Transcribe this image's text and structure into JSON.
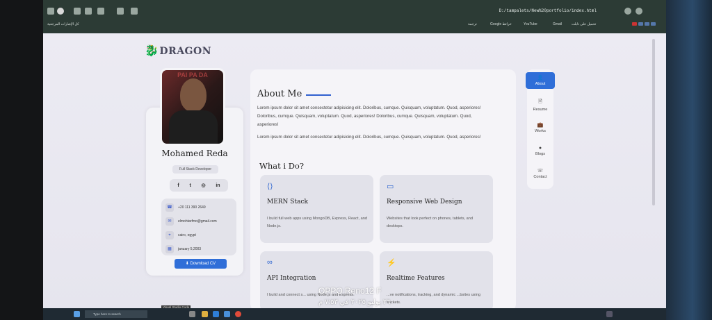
{
  "browser": {
    "url": "D:/tampalets/New%20portfolio/index.html",
    "bookmarks": [
      "تحميل على تابلت",
      "Gmail",
      "YouTube",
      "Google خرائط",
      "ترجمة"
    ],
    "bookmarks_left": "كل الإشارات المرجعية"
  },
  "logo": {
    "text": "DRAGON",
    "mark": "🐉"
  },
  "profile": {
    "photo_text": "PAI PA DA",
    "name": "Mohamed Reda",
    "role": "Full Stack Developer",
    "socials": [
      "f",
      "t",
      "◎",
      "in"
    ],
    "contacts": [
      {
        "icon": "phone-icon",
        "glyph": "☎",
        "text": "+20 111 390 2649"
      },
      {
        "icon": "mail-icon",
        "glyph": "✉",
        "text": "elmohtarfmo@gmail.com"
      },
      {
        "icon": "location-icon",
        "glyph": "⌖",
        "text": "cairo, egypt"
      },
      {
        "icon": "calendar-icon",
        "glyph": "▦",
        "text": "january 5,2003"
      }
    ],
    "download_label": "Download CV"
  },
  "about": {
    "title": "About Me",
    "para1": "Lorem ipsum dolor sit amet consectetur adipisicing elit. Doloribus, cumque. Quisquam, voluptatum. Quod, asperiores! Doloribus, cumque. Quisquam, voluptatum. Quod, asperiores! Doloribus, cumque. Quisquam, voluptatum. Quod, asperiores!",
    "para2": "Lorem ipsum dolor sit amet consectetur adipisicing elit. Doloribus, cumque. Quisquam, voluptatum. Quod, asperiores!",
    "what_title": "What i Do?"
  },
  "services": [
    {
      "icon": "code-icon",
      "glyph": "⟨⟩",
      "title": "MERN Stack",
      "desc": "I build full web apps using MongoDB, Express, React, and Node.js."
    },
    {
      "icon": "monitor-icon",
      "glyph": "▭",
      "title": "Responsive Web Design",
      "desc": "Websites that look perfect on phones, tablets, and desktops."
    },
    {
      "icon": "link-icon",
      "glyph": "∞",
      "title": "API Integration",
      "desc": "I build and connect s... using Node.js and Express."
    },
    {
      "icon": "bolt-icon",
      "glyph": "⚡",
      "title": "Realtime Features",
      "desc": "...ve notifications, tracking, and dynamic ...bsites using sockets."
    }
  ],
  "nav": [
    {
      "label": "About",
      "glyph": "👤",
      "active": true
    },
    {
      "label": "Resume",
      "glyph": "🗎",
      "active": false
    },
    {
      "label": "Works",
      "glyph": "💼",
      "active": false
    },
    {
      "label": "Blogs",
      "glyph": "●",
      "active": false
    },
    {
      "label": "Contact",
      "glyph": "☏",
      "active": false
    }
  ],
  "taskbar": {
    "search_placeholder": "Type here to search",
    "tooltip": "Visual Studio Code"
  },
  "overlay": {
    "brand": "OPPO Reno12 F",
    "date": "٢٦ يوليو ٢٠٢٥ في ٧:٥٣ م"
  }
}
